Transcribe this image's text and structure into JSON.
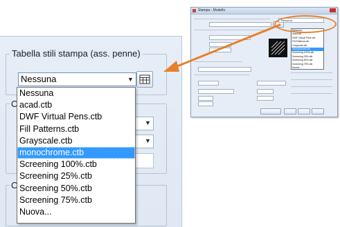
{
  "panel": {
    "group_title": "Tabella stili stampa (ass. penne)",
    "selected_value": "Nessuna",
    "edit_button_icon": "edit-plot-style-icon",
    "hidden_section_letters": [
      "O",
      "O"
    ]
  },
  "dropdown": {
    "items": [
      "Nessuna",
      "acad.ctb",
      "DWF Virtual Pens.ctb",
      "Fill Patterns.ctb",
      "Grayscale.ctb",
      "monochrome.ctb",
      "Screening 100%.ctb",
      "Screening 25%.ctb",
      "Screening 50%.ctb",
      "Screening 75%.ctb",
      "Nuova..."
    ],
    "highlighted": "monochrome.ctb"
  },
  "thumbnail": {
    "title": "Stampa - Modello",
    "highlight_value": "Nessuna"
  },
  "colors": {
    "accent_orange": "#e8802a",
    "selection_blue": "#3399ff",
    "panel_bg": "#e4ecf6"
  }
}
